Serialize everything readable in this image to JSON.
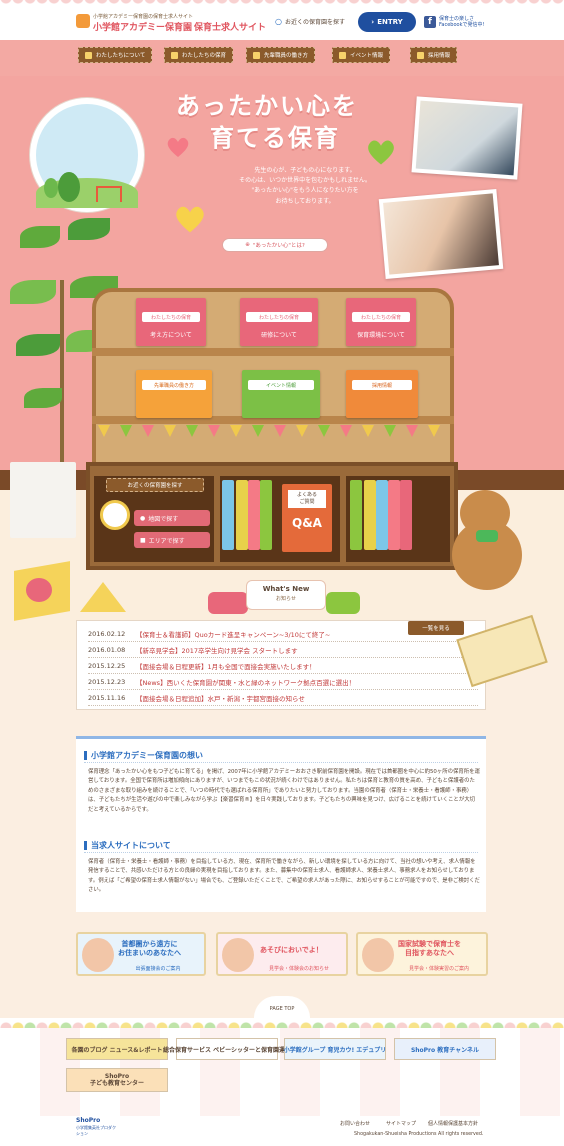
{
  "header": {
    "logo_sub": "小学館アカデミー保育園の保育士求人サイト",
    "logo_main": "小学館アカデミー保育園",
    "logo_main2": "保育士求人サイト",
    "search_label": "お近くの保育園を探す",
    "entry_label": "ENTRY",
    "fb_line1": "保育士の楽しさ",
    "fb_line2": "Facebookで発信中!"
  },
  "nav": {
    "items": [
      "わたしたちについて",
      "わたしたちの保育",
      "先輩職員の働き方",
      "イベント情報",
      "採用情報"
    ]
  },
  "hero": {
    "title_line1": "あったかい心を",
    "title_line2": "育てる保育",
    "copy": [
      "先生の心が、子どもの心になります。",
      "その心は、いつか世界中を包むかもしれません。",
      "\"あったかい心\"をもう人になりたい方を",
      "お待ちしております。"
    ],
    "button": "\"あったかい心\"とは?"
  },
  "shelf": {
    "top_books": [
      {
        "label": "わたしたちの保育",
        "title": "考え方について",
        "color": "#e8677a"
      },
      {
        "label": "わたしたちの保育",
        "title": "研修について",
        "color": "#e8677a"
      },
      {
        "label": "わたしたちの保育",
        "title": "保育環境について",
        "color": "#e8677a"
      }
    ],
    "mid_books": [
      {
        "label": "先輩職員の働き方",
        "color": "#f5a23a"
      },
      {
        "label": "イベント情報",
        "color": "#7cc046"
      },
      {
        "label": "採用情報",
        "color": "#f08a3a"
      }
    ],
    "search_label": "お近くの保育園を探す",
    "map_btn": "地図で探す",
    "area_btn": "エリアで探す",
    "qa_label1": "よくある",
    "qa_label2": "ご質問",
    "qa_text": "Q&A"
  },
  "whats_new": {
    "title": "What's New",
    "subtitle": "お知らせ",
    "more": "一覧を見る"
  },
  "news": [
    {
      "date": "2016.02.12",
      "text": "【保育士＆看護師】Quoカード進呈キャンペーン~3/10にて終了~"
    },
    {
      "date": "2016.01.08",
      "text": "【新卒見学会】2017卒学生向け見学会 スタートします"
    },
    {
      "date": "2015.12.25",
      "text": "【面接会場＆日程更新】1月も全国で面接会実施いたします！"
    },
    {
      "date": "2015.12.23",
      "text": "【News】西いくた保育園が関東・水と緑のネットワーク拠点百選に選出！"
    },
    {
      "date": "2015.11.16",
      "text": "【面接会場＆日程追加】水戸・新潟・宇都宮面接の知らせ"
    }
  ],
  "about": {
    "heading1": "小学館アカデミー保育園の想い",
    "para1": "保育理念「あったかい心をもつ子どもに育てる」を掲げ、2007年に小学館アカデミーおおさき駅前保育園を開設。現在では首都圏を中心に約50ヶ所の保育所を運営しております。全国で保育所は増加傾向にありますが、いつまでもこの状況が続くわけではありません。私たちは保育と教育の質を高め、子どもと保護者のためのさまざまな取り組みを続けることで、「いつの時代でも選ばれる保育所」でありたいと努力しております。当園の保育者（保育士・栄養士・看護師・事務）は、子どもたちが生活や遊びの中で楽しみながら学ぶ【楽習保育®】を日々実践しております。子どもたちの興味を見つけ、広げることを続けていくことが大切だと考えているからです。",
    "heading2": "当求人サイトについて",
    "para2": "保育者（保育士・栄養士・看護師・事務）を目指している方、現在、保育所で働きながら、新しい環境を探している方に向けて、当社の想いや考え、求人情報を発信することで、共感いただける方との良縁の実現を目指しております。また、募集中の保育士求人、看護師求人、栄養士求人、事務求人をお知らせしております。例えば「ご希望の保育士求人情報がない」場合でも、ご登録いただくことで、ご希望の求人があった際に、お知らせすることが可能ですので、是非ご検討ください。"
  },
  "banners": [
    {
      "title": "首都圏から遠方に\nお住まいのあなたへ",
      "sub": "出張面接会のご案内",
      "color": "#2b6dbf"
    },
    {
      "title": "あそびにおいでよ！",
      "sub": "見学会・体験会のお知らせ",
      "color": "#e0555f"
    },
    {
      "title": "国家試験で保育士を\n目指すあなたへ",
      "sub": "見学会・体験実習のご案内",
      "color": "#e0555f"
    }
  ],
  "page_top": "PAGE TOP",
  "footer": {
    "banner1": "各園のブログ ニュース&レポート",
    "banner2": "総合保育サービス ベビーシッターと保育園運営",
    "banner3": "小学館グループ 育児カウ! エデュプリ",
    "banner4": "ShoPro 教育チャンネル",
    "banner5_line1": "ShoPro",
    "banner5_line2": "子ども教育センター",
    "links": [
      "お問い合わせ",
      "サイトマップ",
      "個人情報保護基本方針"
    ],
    "copyright": "Shogakukan-Shueisha Productions All rights reserved.",
    "shopro_logo": "ShoPro",
    "shopro_sub": "小学館集英社プロダクション"
  }
}
